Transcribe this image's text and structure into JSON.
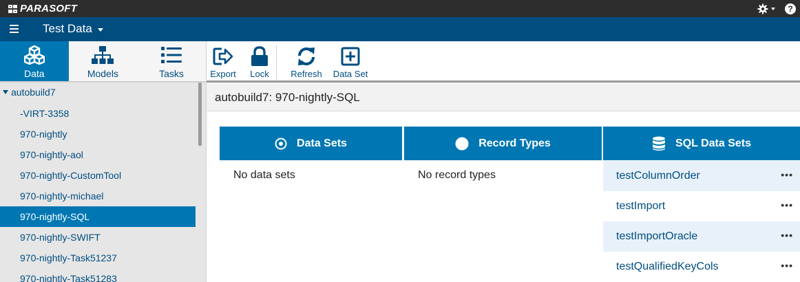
{
  "brand": {
    "name": "PARASOFT"
  },
  "header": {
    "title": "Test Data"
  },
  "left_tabs": [
    {
      "label": "Data",
      "icon": "cubes-icon"
    },
    {
      "label": "Models",
      "icon": "hierarchy-icon"
    },
    {
      "label": "Tasks",
      "icon": "list-icon"
    }
  ],
  "tree": {
    "root": "autobuild7",
    "items": [
      "-VIRT-3358",
      "970-nightly",
      "970-nightly-aol",
      "970-nightly-CustomTool",
      "970-nightly-michael",
      "970-nightly-SQL",
      "970-nightly-SWIFT",
      "970-nightly-Task51237",
      "970-nightly-Task51283"
    ],
    "selected": "970-nightly-SQL"
  },
  "toolbar": {
    "export": "Export",
    "lock": "Lock",
    "refresh": "Refresh",
    "data_set": "Data Set"
  },
  "breadcrumb": "autobuild7: 970-nightly-SQL",
  "columns": {
    "data_sets": {
      "title": "Data Sets",
      "empty": "No data sets"
    },
    "record_types": {
      "title": "Record Types",
      "empty": "No record types"
    },
    "sql_data_sets": {
      "title": "SQL Data Sets",
      "items": [
        "testColumnOrder",
        "testImport",
        "testImportOracle",
        "testQualifiedKeyCols"
      ],
      "more": "•••"
    }
  },
  "colors": {
    "header": "#004d80",
    "accent": "#0077b3",
    "brandbar": "#2d2d2d"
  }
}
